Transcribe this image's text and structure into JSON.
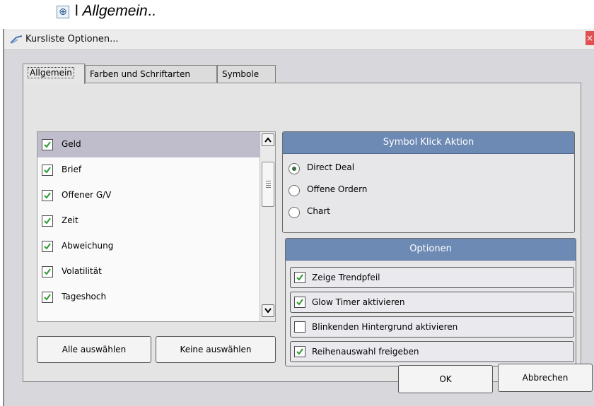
{
  "caption": {
    "prefix": "l ",
    "italic": "Allgemein",
    "suffix": ".."
  },
  "window": {
    "title": "Kursliste Optionen...",
    "close_glyph": "×"
  },
  "tabs": [
    {
      "label": "Allgemein",
      "active": true
    },
    {
      "label": "Farben und Schriftarten",
      "active": false
    },
    {
      "label": "Symbole",
      "active": false
    }
  ],
  "list": {
    "items": [
      {
        "label": "Geld",
        "checked": true,
        "selected": true
      },
      {
        "label": "Brief",
        "checked": true,
        "selected": false
      },
      {
        "label": "Offener G/V",
        "checked": true,
        "selected": false
      },
      {
        "label": "Zeit",
        "checked": true,
        "selected": false
      },
      {
        "label": "Abweichung",
        "checked": true,
        "selected": false
      },
      {
        "label": "Volatilität",
        "checked": true,
        "selected": false
      },
      {
        "label": "Tageshoch",
        "checked": true,
        "selected": false
      }
    ]
  },
  "buttons": {
    "select_all": "Alle auswählen",
    "select_none": "Keine auswählen",
    "ok": "OK",
    "cancel": "Abbrechen"
  },
  "symbol_click": {
    "title": "Symbol Klick Aktion",
    "options": [
      {
        "label": "Direct Deal",
        "checked": true
      },
      {
        "label": "Offene Ordern",
        "checked": false
      },
      {
        "label": "Chart",
        "checked": false
      }
    ]
  },
  "options": {
    "title": "Optionen",
    "items": [
      {
        "label": "Zeige Trendpfeil",
        "checked": true
      },
      {
        "label": "Glow Timer aktivieren",
        "checked": true
      },
      {
        "label": "Blinkenden Hintergrund aktivieren",
        "checked": false
      },
      {
        "label": "Reihenauswahl freigeben",
        "checked": true
      }
    ]
  },
  "colors": {
    "header_blue": "#6d8ab5",
    "check_green": "#2e9a2e",
    "selected_row": "#bfbdcc"
  }
}
